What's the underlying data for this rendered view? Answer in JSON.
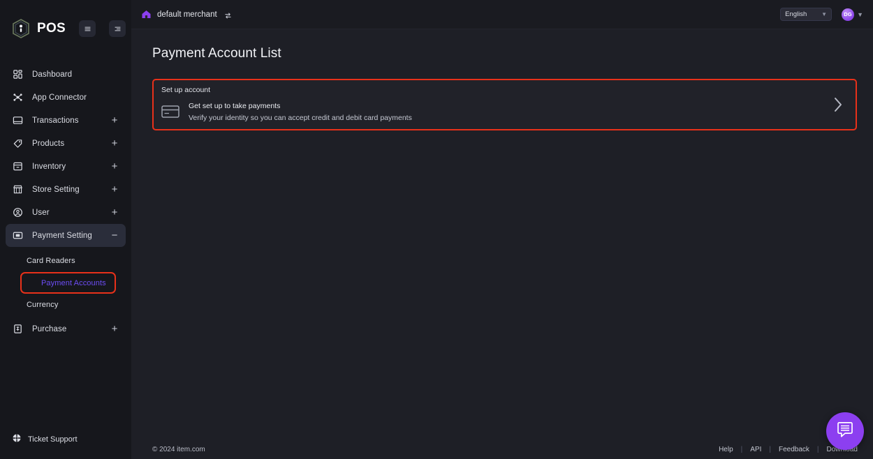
{
  "brand": {
    "name": "POS",
    "accent": "#8c3ff0",
    "highlight": "#e8311a",
    "link_purple": "#6d4df6"
  },
  "sidebar": {
    "toggle_buttons": [
      {
        "name": "menu-toggle",
        "icon": "list-icon"
      },
      {
        "name": "collapse-toggle",
        "icon": "collapse-icon"
      }
    ],
    "items": [
      {
        "label": "Dashboard",
        "icon": "grid-icon",
        "expandable": false,
        "active": false
      },
      {
        "label": "App Connector",
        "icon": "nodes-icon",
        "expandable": false,
        "active": false
      },
      {
        "label": "Transactions",
        "icon": "monitor-icon",
        "expandable": true,
        "expander": "+",
        "active": false
      },
      {
        "label": "Products",
        "icon": "tag-icon",
        "expandable": true,
        "expander": "+",
        "active": false
      },
      {
        "label": "Inventory",
        "icon": "box-icon",
        "expandable": true,
        "expander": "+",
        "active": false
      },
      {
        "label": "Store Setting",
        "icon": "store-icon",
        "expandable": true,
        "expander": "+",
        "active": false
      },
      {
        "label": "User",
        "icon": "user-icon",
        "expandable": true,
        "expander": "+",
        "active": false
      },
      {
        "label": "Payment Setting",
        "icon": "card-terminal-icon",
        "expandable": true,
        "expander": "−",
        "active": true
      }
    ],
    "sub_items": [
      {
        "label": "Card Readers",
        "highlighted": false
      },
      {
        "label": "Payment Accounts",
        "highlighted": true
      },
      {
        "label": "Currency",
        "highlighted": false
      }
    ],
    "items_after": [
      {
        "label": "Purchase",
        "icon": "receipt-icon",
        "expandable": true,
        "expander": "+",
        "active": false
      }
    ],
    "support": {
      "label": "Ticket Support",
      "icon": "ticket-icon"
    }
  },
  "topbar": {
    "merchant": "default merchant",
    "home_icon": "home-icon",
    "switch_icon": "swap-icon",
    "language": {
      "selected": "English",
      "options": [
        "English"
      ]
    },
    "user": {
      "initials": "DG"
    }
  },
  "main": {
    "page_title": "Payment Account List",
    "setup_card": {
      "header": "Set up account",
      "title": "Get set up to take payments",
      "description": "Verify your identity so you can accept credit and debit card payments",
      "icon": "credit-card-icon",
      "arrow_icon": "chevron-right-icon"
    }
  },
  "footer": {
    "copyright": "© 2024 item.com",
    "links": [
      "Help",
      "API",
      "Feedback",
      "Download"
    ],
    "separator": "|"
  },
  "chat": {
    "icon": "chat-bubble-icon"
  }
}
